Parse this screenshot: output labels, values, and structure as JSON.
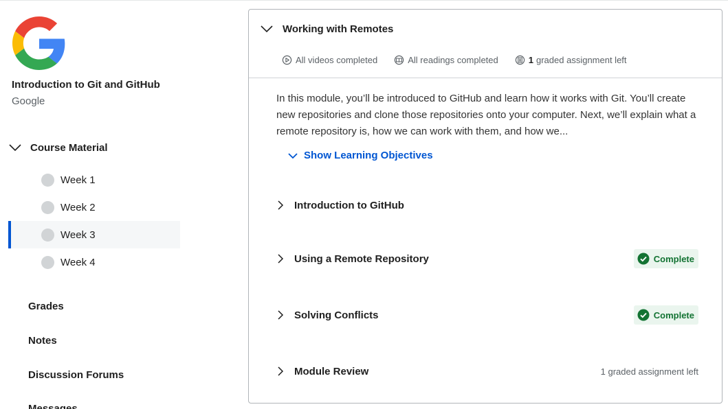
{
  "course": {
    "title": "Introduction to Git and GitHub",
    "org": "Google"
  },
  "sidebar": {
    "section_label": "Course Material",
    "weeks": [
      {
        "label": "Week 1"
      },
      {
        "label": "Week 2"
      },
      {
        "label": "Week 3",
        "active": true
      },
      {
        "label": "Week 4"
      }
    ],
    "links": [
      {
        "label": "Grades"
      },
      {
        "label": "Notes"
      },
      {
        "label": "Discussion Forums"
      },
      {
        "label": "Messages"
      }
    ]
  },
  "module": {
    "title": "Working with Remotes",
    "meta": {
      "videos": "All videos completed",
      "readings": "All readings completed",
      "graded_count": "1",
      "graded_text": "graded assignment left"
    },
    "description": "In this module, you’ll be introduced to GitHub and learn how it works with Git. You’ll create new repositories and clone those repositories onto your computer. Next, we’ll explain what a remote repository is, how we can work with them, and how we...",
    "objectives_label": "Show Learning Objectives",
    "lessons": [
      {
        "title": "Introduction to GitHub",
        "status": ""
      },
      {
        "title": "Using a Remote Repository",
        "status": "Complete"
      },
      {
        "title": "Solving Conflicts",
        "status": "Complete"
      },
      {
        "title": "Module Review",
        "status": "1 graded assignment left"
      }
    ]
  },
  "colors": {
    "accent": "#0056d2",
    "complete_text": "#137333",
    "complete_bg": "#eaf5ee"
  }
}
